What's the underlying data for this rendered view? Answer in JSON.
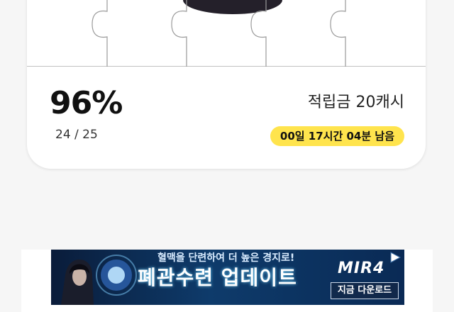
{
  "progress": {
    "percent_label": "96%",
    "percent": 96,
    "count_label": "24 / 25",
    "collected": 24,
    "total": 25
  },
  "reward": {
    "label": "적립금 20캐시"
  },
  "timer": {
    "label": "00일 17시간 04분 남음",
    "badge_color": "#ffe44d"
  },
  "ad": {
    "tagline": "혈맥을 단련하여 더 높은 경지로!",
    "title": "폐관수련 업데이트",
    "logo": "MIR4",
    "cta": "지금 다운로드"
  },
  "icons": [
    "puzzle-board",
    "play-icon"
  ]
}
